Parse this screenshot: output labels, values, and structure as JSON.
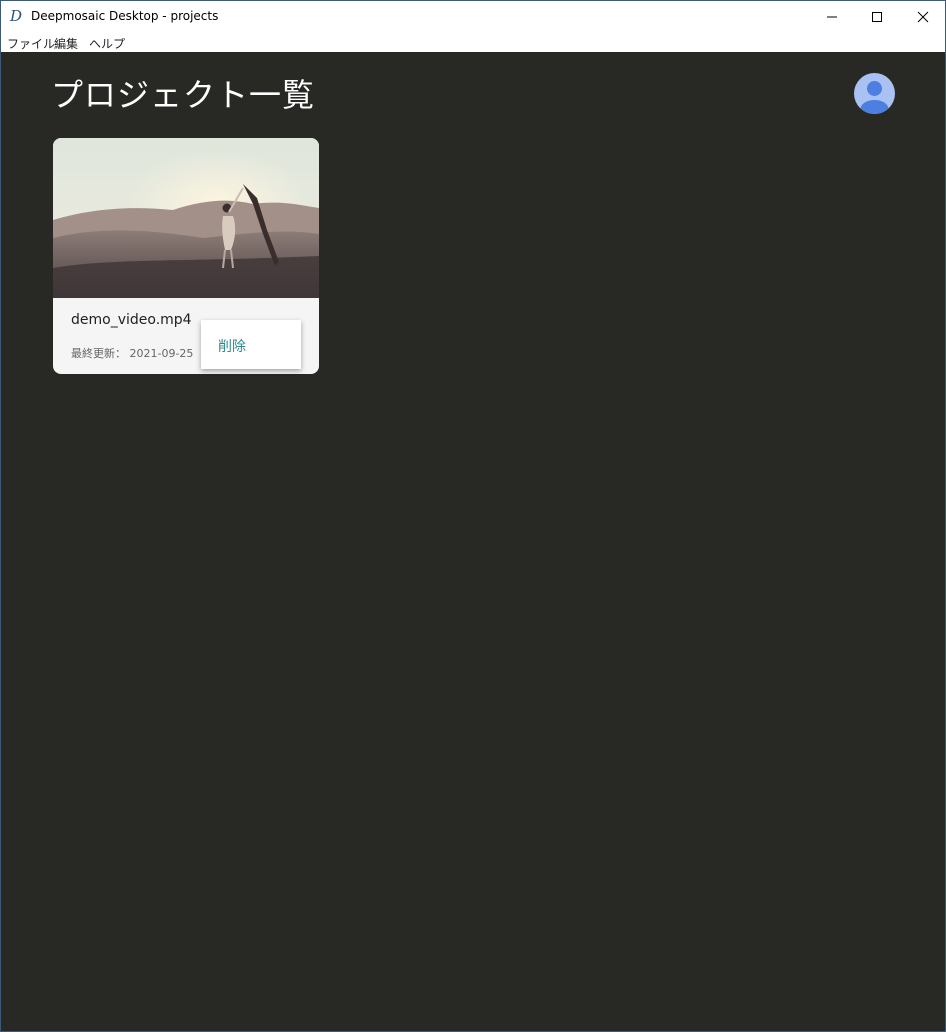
{
  "window": {
    "title": "Deepmosaic Desktop - projects",
    "app_icon_glyph": "D"
  },
  "menu": {
    "items": [
      "ファイル",
      "編集",
      "ヘルプ"
    ]
  },
  "page": {
    "title": "プロジェクト一覧"
  },
  "projects": [
    {
      "name": "demo_video.mp4",
      "updated": "最終更新： 2021-09-25"
    }
  ],
  "context_menu": {
    "items": [
      "削除"
    ]
  },
  "colors": {
    "background": "#282824",
    "accent_text": "#2a8c8a",
    "avatar": "#a9c2f3"
  },
  "icons": {
    "minimize": "minimize-icon",
    "maximize": "maximize-icon",
    "close": "close-icon",
    "avatar": "user-avatar-icon"
  }
}
